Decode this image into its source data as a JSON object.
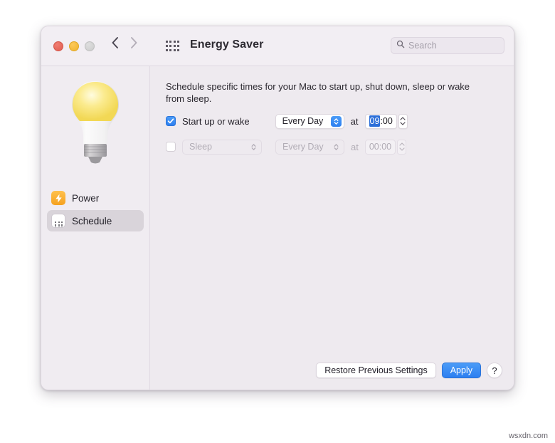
{
  "window": {
    "title": "Energy Saver",
    "traffic_lights": [
      "close",
      "minimize",
      "zoom"
    ],
    "back_label": "Back",
    "forward_label": "Forward",
    "grid_label": "Show All"
  },
  "search": {
    "placeholder": "Search",
    "value": "",
    "icon": "search-icon"
  },
  "sidebar": {
    "hero_icon": "lightbulb-icon",
    "items": [
      {
        "label": "Power",
        "icon": "power-bolt-icon",
        "selected": false
      },
      {
        "label": "Schedule",
        "icon": "calendar-schedule-icon",
        "selected": true
      }
    ]
  },
  "main": {
    "description": "Schedule specific times for your Mac to start up, shut down, sleep or wake from sleep.",
    "at_label": "at",
    "rows": [
      {
        "checkbox_label": "Start up or wake",
        "checked": true,
        "enabled": true,
        "day_value": "Every Day",
        "at_label": "at",
        "time_hour": "09",
        "time_rest": ":00",
        "hour_selected": true
      },
      {
        "action_value": "Sleep",
        "checked": false,
        "enabled": false,
        "day_value": "Every Day",
        "at_label": "at",
        "time_hour": "00",
        "time_rest": ":00",
        "hour_selected": false
      }
    ]
  },
  "footer": {
    "restore_label": "Restore Previous Settings",
    "apply_label": "Apply",
    "help_label": "?"
  },
  "watermark": "wsxdn.com",
  "colors": {
    "accent_blue": "#2d7ff0",
    "selection_blue": "#2d6fd8",
    "window_bg": "#f0ecf1",
    "content_bg": "#eeeaef",
    "sidebar_selected": "#d9d4da",
    "power_icon_orange": "#f5a11f",
    "calendar_red": "#e8453c",
    "bulb_yellow": "#f7e06a"
  }
}
